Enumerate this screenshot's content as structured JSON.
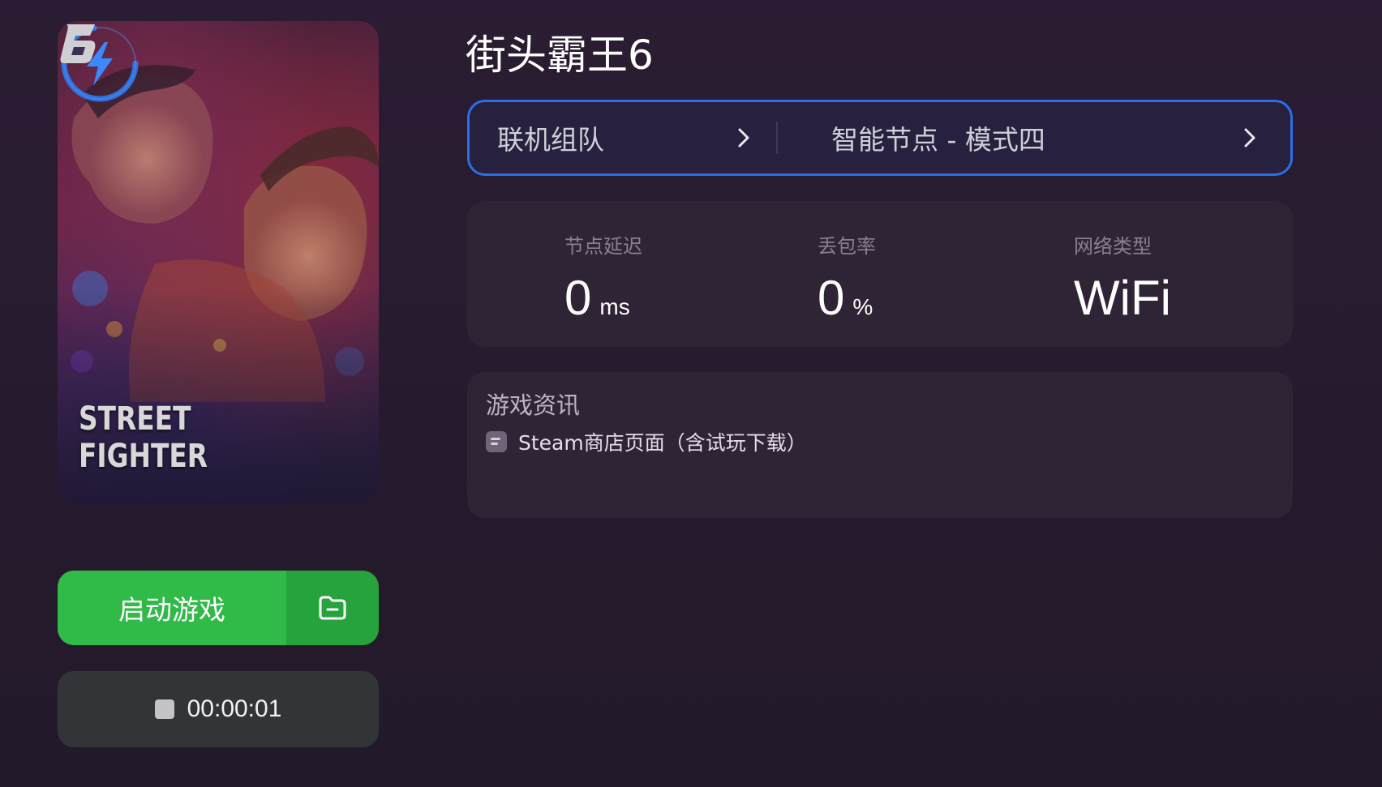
{
  "cover": {
    "title_art": "STREET FIGHTER",
    "emblem": "6",
    "overlay_icon": "lightning-boost-icon"
  },
  "launch": {
    "label": "启动游戏",
    "folder_icon": "folder-icon"
  },
  "timer": {
    "icon": "stop-icon",
    "elapsed": "00:00:01"
  },
  "game": {
    "title": "街头霸王6"
  },
  "mode_bar": {
    "left_label": "联机组队",
    "right_label": "智能节点 - 模式四",
    "chevron_icon": "chevron-right-icon",
    "border_color": "#2a6fe6"
  },
  "stats": {
    "latency": {
      "label": "节点延迟",
      "value": "0",
      "unit": "ms"
    },
    "packet_loss": {
      "label": "丢包率",
      "value": "0",
      "unit": "%"
    },
    "network": {
      "label": "网络类型",
      "value": "WiFi"
    }
  },
  "news": {
    "title": "游戏资讯",
    "items": [
      {
        "icon": "document-icon",
        "text": "Steam商店页面（含试玩下载）"
      }
    ]
  },
  "colors": {
    "launch_green": "#30bb49",
    "launch_green_dark": "#26a33d",
    "accent_blue": "#2a6fe6"
  }
}
